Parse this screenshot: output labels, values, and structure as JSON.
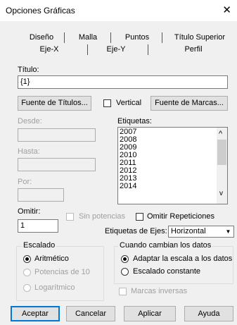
{
  "window": {
    "title": "Opciones Gráficas",
    "close_glyph": "✕"
  },
  "tabs_row1": [
    "Diseño",
    "Malla",
    "Puntos",
    "Título Superior"
  ],
  "tabs_row2": [
    "Eje-X",
    "Eje-Y",
    "Perfil"
  ],
  "titulo": {
    "label": "Título:",
    "value": "{1}"
  },
  "buttons": {
    "fuente_titulos": "Fuente de Títulos...",
    "fuente_marcas": "Fuente de Marcas...",
    "aceptar": "Aceptar",
    "cancelar": "Cancelar",
    "aplicar": "Aplicar",
    "ayuda": "Ayuda"
  },
  "vertical": {
    "label": "Vertical",
    "checked": false
  },
  "desde": {
    "label": "Desde:",
    "value": ""
  },
  "hasta": {
    "label": "Hasta:",
    "value": ""
  },
  "por": {
    "label": "Por:",
    "value": ""
  },
  "etiquetas": {
    "label": "Etiquetas:",
    "items": [
      "2007",
      "2008",
      "2009",
      "2010",
      "2011",
      "2012",
      "2013",
      "2014"
    ],
    "scroll_up": "^",
    "scroll_down": "v"
  },
  "omitir": {
    "label": "Omitir:",
    "value": "1"
  },
  "sin_potencias": {
    "label": "Sin potencias",
    "checked": false
  },
  "omitir_repeticiones": {
    "label": "Omitir Repeticiones",
    "checked": false
  },
  "etiquetas_ejes": {
    "label": "Etiquetas de Ejes:",
    "selected": "Horizontal",
    "arrow": "▼"
  },
  "escalado": {
    "legend": "Escalado",
    "options": [
      "Aritmético",
      "Potencias de 10",
      "Logarítmico"
    ],
    "selected": "Aritmético"
  },
  "cuando_cambian": {
    "legend": "Cuando cambian los datos",
    "options": [
      "Adaptar la escala a los datos",
      "Escalado constante"
    ],
    "selected": "Adaptar la escala a los datos"
  },
  "marcas_inversas": {
    "label": "Marcas inversas",
    "checked": false
  }
}
